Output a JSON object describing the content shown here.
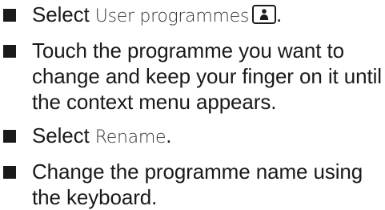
{
  "steps": [
    {
      "pre": "Select ",
      "ui": "User programmes",
      "icon": "user-programmes-icon",
      "post": "."
    },
    {
      "pre": "Touch the programme you want to change and keep your finger on it until the context menu appears."
    },
    {
      "pre": "Select ",
      "ui": "Rename",
      "post": "."
    },
    {
      "pre": "Change the programme name using the keyboard."
    }
  ]
}
